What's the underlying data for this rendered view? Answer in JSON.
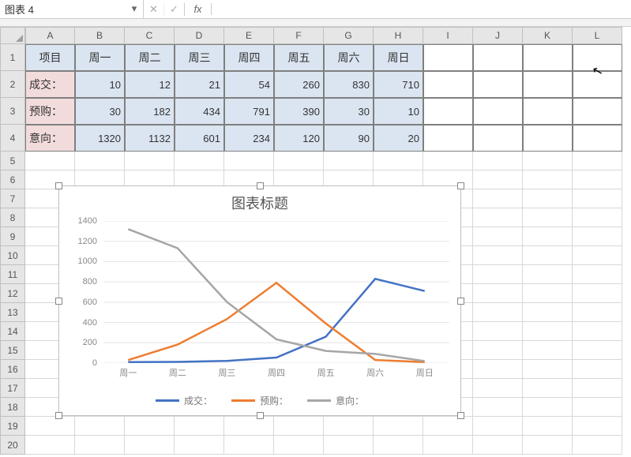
{
  "namebox": {
    "value": "图表 4"
  },
  "fx": {
    "cancel": "✕",
    "confirm": "✓",
    "label": "fx"
  },
  "cols": [
    "A",
    "B",
    "C",
    "D",
    "E",
    "F",
    "G",
    "H",
    "I",
    "J",
    "K",
    "L"
  ],
  "rows_labels": [
    "1",
    "2",
    "3",
    "4",
    "5",
    "6",
    "7",
    "8",
    "9",
    "10",
    "11",
    "12",
    "13",
    "14",
    "15",
    "16",
    "17",
    "18",
    "19",
    "20"
  ],
  "table": {
    "corner": "项目",
    "headers": [
      "周一",
      "周二",
      "周三",
      "周四",
      "周五",
      "周六",
      "周日"
    ],
    "rows": [
      {
        "label": "成交：",
        "values": [
          "10",
          "12",
          "21",
          "54",
          "260",
          "830",
          "710"
        ]
      },
      {
        "label": "预购：",
        "values": [
          "30",
          "182",
          "434",
          "791",
          "390",
          "30",
          "10"
        ]
      },
      {
        "label": "意向：",
        "values": [
          "1320",
          "1132",
          "601",
          "234",
          "120",
          "90",
          "20"
        ]
      }
    ]
  },
  "chart_data": {
    "type": "line",
    "title": "图表标题",
    "categories": [
      "周一",
      "周二",
      "周三",
      "周四",
      "周五",
      "周六",
      "周日"
    ],
    "series": [
      {
        "name": "成交：",
        "values": [
          10,
          12,
          21,
          54,
          260,
          830,
          710
        ],
        "color": "#4472c4"
      },
      {
        "name": "预购：",
        "values": [
          30,
          182,
          434,
          791,
          390,
          30,
          10
        ],
        "color": "#ed7d31"
      },
      {
        "name": "意向：",
        "values": [
          1320,
          1132,
          601,
          234,
          120,
          90,
          20
        ],
        "color": "#a6a6a6"
      }
    ],
    "xlabel": "",
    "ylabel": "",
    "ylim": [
      0,
      1400
    ],
    "yticks": [
      0,
      200,
      400,
      600,
      800,
      1000,
      1200,
      1400
    ]
  }
}
